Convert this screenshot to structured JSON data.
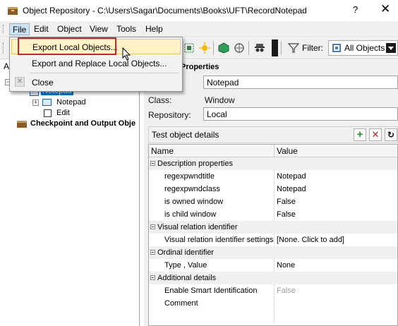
{
  "window": {
    "title": "Object Repository - C:\\Users\\Sagar\\Documents\\Books\\UFT\\RecordNotepad",
    "help_label": "?",
    "close_label": "✕"
  },
  "menubar": {
    "items": [
      {
        "label": "File",
        "active": true
      },
      {
        "label": "Edit"
      },
      {
        "label": "Object"
      },
      {
        "label": "View"
      },
      {
        "label": "Tools"
      },
      {
        "label": "Help"
      }
    ]
  },
  "toolbar": {
    "filter_label": "Filter:",
    "filter_value": "All Objects",
    "left_edge_label": "A"
  },
  "file_menu": {
    "items": [
      {
        "label": "Export Local Objects...",
        "highlighted": true
      },
      {
        "label": "Export and Replace Local Objects..."
      },
      {
        "label": "Close"
      }
    ]
  },
  "tree": {
    "selected_node": "Notepad",
    "nodes": [
      {
        "label": "Notepad",
        "level": 1
      },
      {
        "label": "Edit",
        "level": 1
      },
      {
        "label": "Checkpoint and Output Obje",
        "level": 0
      }
    ]
  },
  "properties": {
    "section_title": "Properties",
    "name_label": "",
    "name_value": "Notepad",
    "class_label": "Class:",
    "class_value": "Window",
    "repository_label": "Repository:",
    "repository_value": "Local",
    "details_title": "Test object details"
  },
  "grid": {
    "col_name": "Name",
    "col_value": "Value",
    "rows": [
      {
        "type": "category",
        "name": "Description properties"
      },
      {
        "type": "prop",
        "name": "regexpwndtitle",
        "value": "Notepad"
      },
      {
        "type": "prop",
        "name": "regexpwndclass",
        "value": "Notepad"
      },
      {
        "type": "prop",
        "name": "is owned window",
        "value": "False"
      },
      {
        "type": "prop",
        "name": "is child window",
        "value": "False"
      },
      {
        "type": "category",
        "name": "Visual relation identifier"
      },
      {
        "type": "prop",
        "name": "Visual relation identifier settings",
        "value": "[None. Click to add]"
      },
      {
        "type": "category",
        "name": "Ordinal identifier"
      },
      {
        "type": "prop",
        "name": "Type , Value",
        "value": "None"
      },
      {
        "type": "category",
        "name": "Additional details"
      },
      {
        "type": "prop",
        "name": "Enable Smart Identification",
        "value": "False",
        "disabled": true
      },
      {
        "type": "prop",
        "name": "Comment",
        "value": ""
      }
    ]
  },
  "colors": {
    "highlight": "#fff3c7",
    "selection": "#0078d7",
    "annotation_red": "#d0202a"
  }
}
